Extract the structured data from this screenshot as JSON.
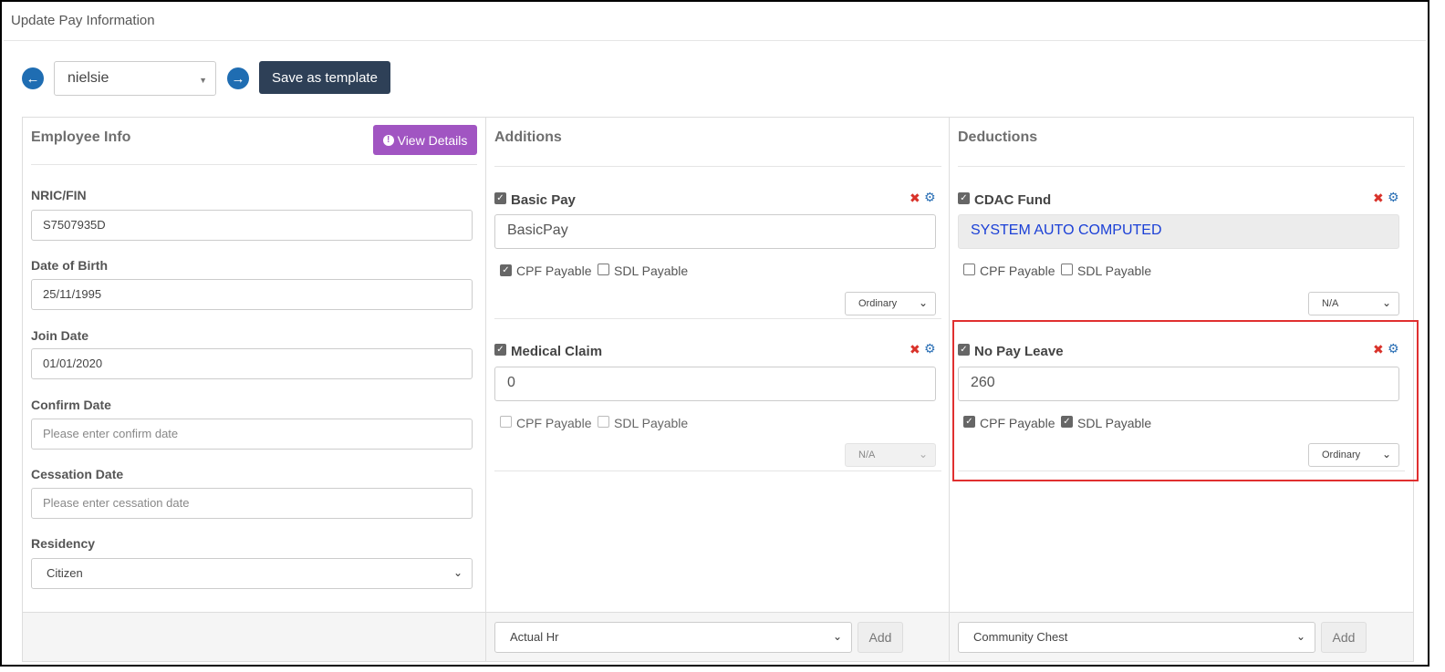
{
  "page": {
    "title": "Update Pay Information"
  },
  "toolbar": {
    "prev_icon": "arrow-left-circle",
    "next_icon": "arrow-right-circle",
    "employee_value": "nielsie",
    "save_template_label": "Save as template"
  },
  "employee_info": {
    "heading": "Employee Info",
    "view_details_label": "View Details",
    "fields": {
      "nric_label": "NRIC/FIN",
      "nric_value": "S7507935D",
      "dob_label": "Date of Birth",
      "dob_value": "25/11/1995",
      "join_label": "Join Date",
      "join_value": "01/01/2020",
      "confirm_label": "Confirm Date",
      "confirm_placeholder": "Please enter confirm date",
      "cessation_label": "Cessation Date",
      "cessation_placeholder": "Please enter cessation date",
      "residency_label": "Residency",
      "residency_value": "Citizen"
    }
  },
  "additions": {
    "heading": "Additions",
    "items": [
      {
        "title": "Basic Pay",
        "value": "BasicPay",
        "cpf_label": "CPF Payable",
        "sdl_label": "SDL Payable",
        "type": "Ordinary"
      },
      {
        "title": "Medical Claim",
        "value": "0",
        "cpf_label": "CPF Payable",
        "sdl_label": "SDL Payable",
        "type": "N/A"
      }
    ],
    "add_select_value": "Actual Hr",
    "add_label": "Add"
  },
  "deductions": {
    "heading": "Deductions",
    "items": [
      {
        "title": "CDAC Fund",
        "value": "SYSTEM AUTO COMPUTED",
        "cpf_label": "CPF Payable",
        "sdl_label": "SDL Payable",
        "type": "N/A"
      },
      {
        "title": "No Pay Leave",
        "value": "260",
        "cpf_label": "CPF Payable",
        "sdl_label": "SDL Payable",
        "type": "Ordinary"
      }
    ],
    "add_select_value": "Community Chest",
    "add_label": "Add"
  },
  "colors": {
    "primary": "#1f6db2",
    "dark_button": "#2e4057",
    "purple": "#a155c2",
    "remove": "#d9322a",
    "highlight": "#e03030"
  }
}
